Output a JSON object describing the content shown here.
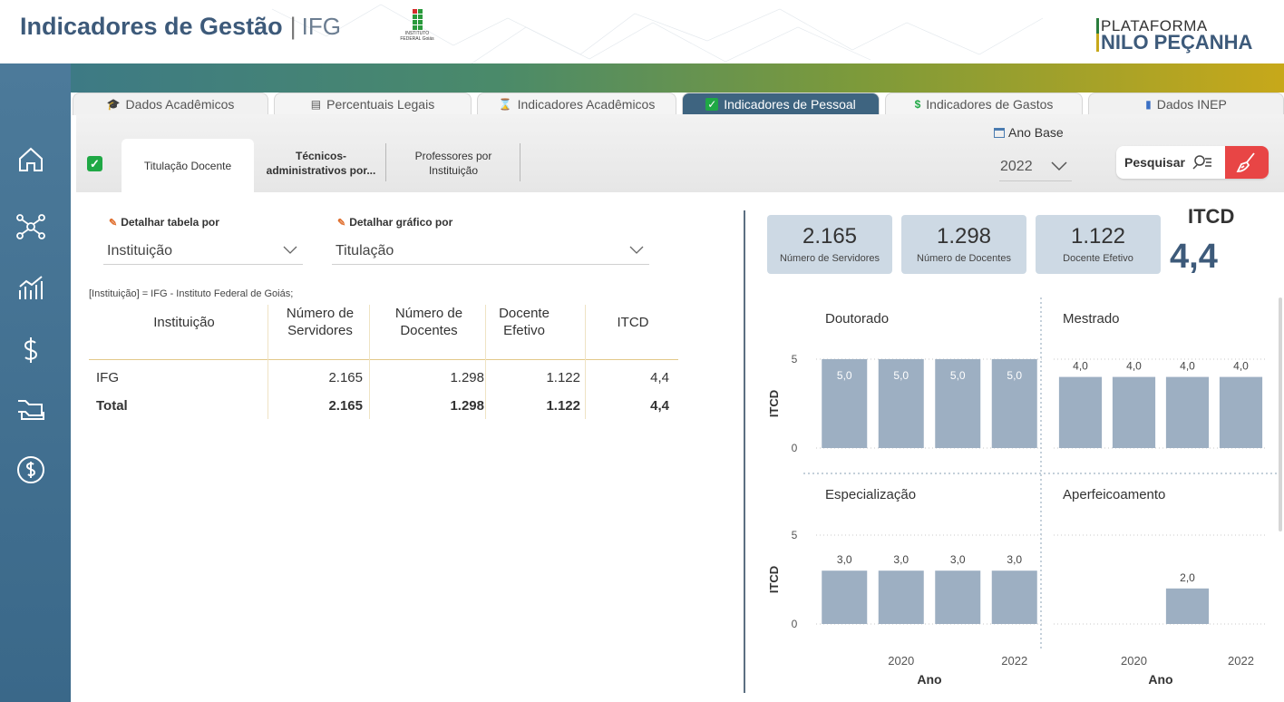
{
  "header": {
    "title": "Indicadores de Gestão",
    "separator": "|",
    "subtitle": "IFG",
    "logo_text": "INSTITUTO FEDERAL Goiás",
    "brand_top": "PLATAFORMA",
    "brand_bottom": "NILO PEÇANHA"
  },
  "sidebar": {
    "icons": [
      "home-icon",
      "network-icon",
      "chart-icon",
      "dollar-icon",
      "card-icon",
      "refresh-money-icon"
    ]
  },
  "tabs": [
    {
      "label": "Dados Acadêmicos",
      "icon": "🎓"
    },
    {
      "label": "Percentuais Legais",
      "icon": "▤"
    },
    {
      "label": "Indicadores Acadêmicos",
      "icon": "⌛"
    },
    {
      "label": "Indicadores de Pessoal",
      "icon": "✓"
    },
    {
      "label": "Indicadores de Gastos",
      "icon": "$"
    },
    {
      "label": "Dados INEP",
      "icon": "▮"
    }
  ],
  "subtabs": {
    "active": "Titulação Docente",
    "tecnicos_1": "Técnicos-",
    "tecnicos_2": "administrativos por...",
    "prof_1": "Professores por",
    "prof_2": "Instituição"
  },
  "ano_base": {
    "label": "Ano Base",
    "value": "2022"
  },
  "pesquisar": {
    "label": "Pesquisar"
  },
  "detalhar": {
    "tabela_label": "Detalhar tabela por",
    "tabela_value": "Instituição",
    "grafico_label": "Detalhar gráfico por",
    "grafico_value": "Titulação"
  },
  "filter_text": "[Instituição] = IFG - Instituto Federal de Goiás;",
  "table": {
    "headers": {
      "instituicao": "Instituição",
      "servidores_1": "Número de",
      "servidores_2": "Servidores",
      "docentes_1": "Número de",
      "docentes_2": "Docentes",
      "efetivo_1": "Docente",
      "efetivo_2": "Efetivo",
      "itcd": "ITCD"
    },
    "rows": [
      {
        "inst": "IFG",
        "serv": "2.165",
        "doc": "1.298",
        "ef": "1.122",
        "itcd": "4,4"
      }
    ],
    "total": {
      "inst": "Total",
      "serv": "2.165",
      "doc": "1.298",
      "ef": "1.122",
      "itcd": "4,4"
    }
  },
  "kpis": [
    {
      "value": "2.165",
      "label": "Número de Servidores"
    },
    {
      "value": "1.298",
      "label": "Número de Docentes"
    },
    {
      "value": "1.122",
      "label": "Docente Efetivo"
    }
  ],
  "itcd": {
    "title": "ITCD",
    "value": "4,4"
  },
  "colors": {
    "bar": "#9dafc2",
    "active_tab": "#3e6480",
    "accent_red": "#e84545",
    "check_green": "#1fa845"
  },
  "chart_data": {
    "type": "bar",
    "ylabel": "ITCD",
    "xlabel": "Ano",
    "ylim": [
      0,
      5
    ],
    "y_ticks": [
      "0",
      "5"
    ],
    "x_tick_labels": [
      "2020",
      "2022"
    ],
    "panels": [
      {
        "name": "Doutorado",
        "x": [
          2019,
          2020,
          2021,
          2022
        ],
        "values": [
          5.0,
          5.0,
          5.0,
          5.0
        ],
        "labels": [
          "5,0",
          "5,0",
          "5,0",
          "5,0"
        ]
      },
      {
        "name": "Mestrado",
        "x": [
          2019,
          2020,
          2021,
          2022
        ],
        "values": [
          4.0,
          4.0,
          4.0,
          4.0
        ],
        "labels": [
          "4,0",
          "4,0",
          "4,0",
          "4,0"
        ]
      },
      {
        "name": "Especialização",
        "x": [
          2019,
          2020,
          2021,
          2022
        ],
        "values": [
          3.0,
          3.0,
          3.0,
          3.0
        ],
        "labels": [
          "3,0",
          "3,0",
          "3,0",
          "3,0"
        ]
      },
      {
        "name": "Aperfeicoamento",
        "x": [
          2021
        ],
        "values": [
          2.0
        ],
        "labels": [
          "2,0"
        ]
      }
    ]
  }
}
